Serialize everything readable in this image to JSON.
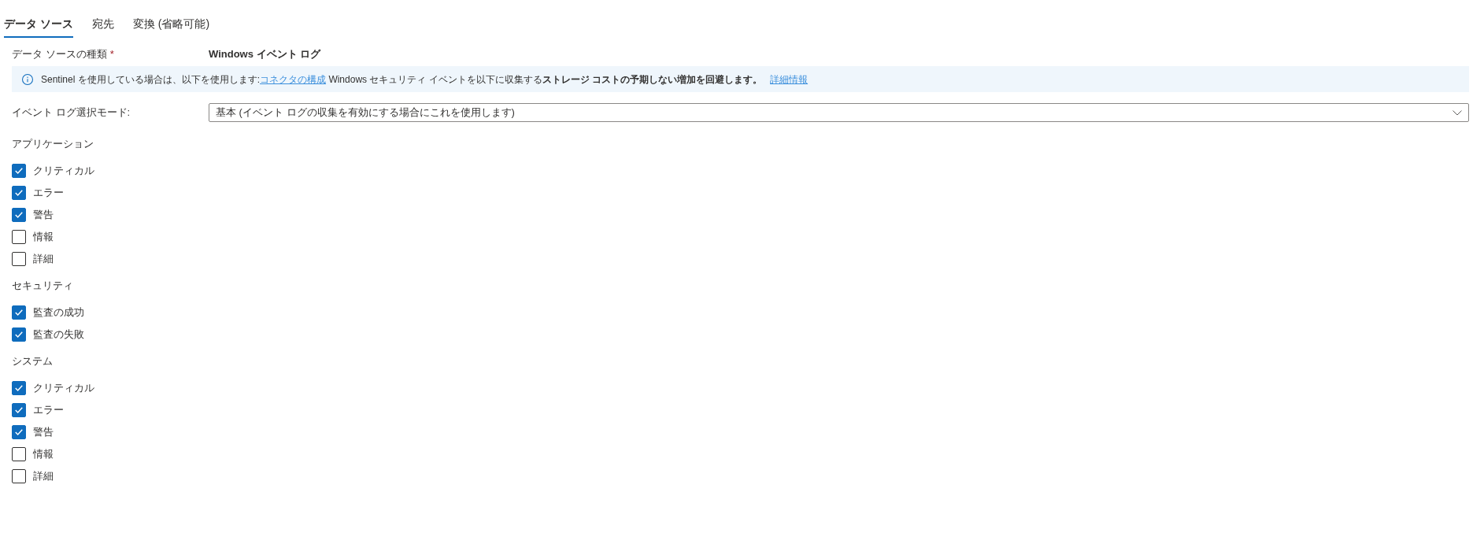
{
  "tabs": [
    {
      "label": "データ ソース",
      "selected": true
    },
    {
      "label": "宛先",
      "selected": false
    },
    {
      "label": "変換 (省略可能)",
      "selected": false
    }
  ],
  "data_source_type": {
    "label": "データ ソースの種類",
    "required_mark": "*",
    "value": "Windows イベント ログ"
  },
  "info_banner": {
    "segments": [
      {
        "kind": "text",
        "text": "Sentinel を使用している場合は、以下を使用します:"
      },
      {
        "kind": "link",
        "text": "コネクタの構成"
      },
      {
        "kind": "text",
        "text": " Windows セキュリティ イベントを以下に収集する**ストレージ コストの予期しない増加を回避します。**"
      }
    ],
    "link": "詳細情報"
  },
  "event_log_mode": {
    "label": "イベント ログ選択モード:",
    "value": "基本 (イベント ログの収集を有効にする場合にこれを使用します)"
  },
  "sections": [
    {
      "title": "アプリケーション",
      "options": [
        {
          "label": "クリティカル",
          "checked": true
        },
        {
          "label": "エラー",
          "checked": true
        },
        {
          "label": "警告",
          "checked": true
        },
        {
          "label": "情報",
          "checked": false
        },
        {
          "label": "詳細",
          "checked": false
        }
      ]
    },
    {
      "title": "セキュリティ",
      "options": [
        {
          "label": "監査の成功",
          "checked": true
        },
        {
          "label": "監査の失敗",
          "checked": true
        }
      ]
    },
    {
      "title": "システム",
      "options": [
        {
          "label": "クリティカル",
          "checked": true
        },
        {
          "label": "エラー",
          "checked": true
        },
        {
          "label": "警告",
          "checked": true
        },
        {
          "label": "情報",
          "checked": false
        },
        {
          "label": "詳細",
          "checked": false
        }
      ]
    }
  ]
}
